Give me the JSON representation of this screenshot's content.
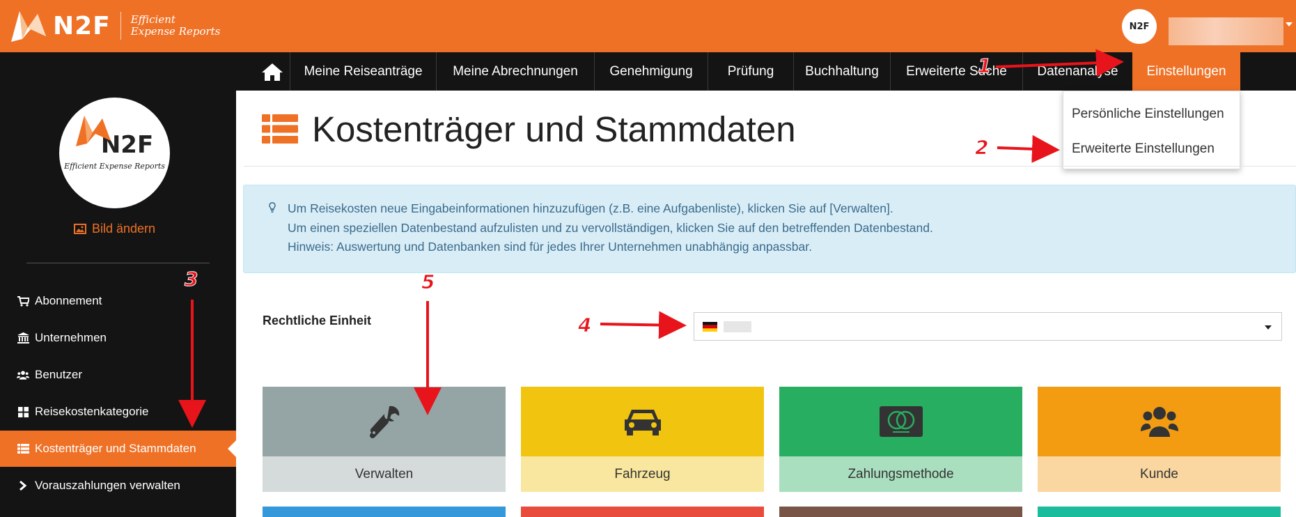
{
  "brand": {
    "logo_text": "N2F",
    "tagline_line1": "Efficient",
    "tagline_line2": "Expense Reports",
    "orange": "#ef7126",
    "dark": "#141414"
  },
  "header": {
    "avatar_text": "N2F"
  },
  "nav": {
    "home_icon": "home-icon",
    "items": [
      {
        "label": "Meine Reiseanträge"
      },
      {
        "label": "Meine Abrechnungen"
      },
      {
        "label": "Genehmigung"
      },
      {
        "label": "Prüfung"
      },
      {
        "label": "Buchhaltung"
      },
      {
        "label": "Erweiterte Suche"
      },
      {
        "label": "Datenanalyse"
      },
      {
        "label": "Einstellungen"
      }
    ]
  },
  "dropdown": {
    "items": [
      {
        "label": "Persönliche Einstellungen"
      },
      {
        "label": "Erweiterte Einstellungen"
      }
    ]
  },
  "sidebar": {
    "change_image": "Bild ändern",
    "logo_text": "N2F",
    "logo_tagline": "Efficient Expense Reports",
    "items": [
      {
        "label": "Abonnement",
        "icon": "cart-icon"
      },
      {
        "label": "Unternehmen",
        "icon": "bank-icon"
      },
      {
        "label": "Benutzer",
        "icon": "users-icon"
      },
      {
        "label": "Reisekostenkategorie",
        "icon": "grid-icon"
      },
      {
        "label": "Kostenträger und Stammdaten",
        "icon": "list-icon",
        "active": true
      },
      {
        "label": "Vorauszahlungen verwalten",
        "icon": "chevron-right-icon"
      }
    ]
  },
  "main": {
    "title": "Kostenträger und Stammdaten",
    "info": {
      "line1": "Um Reisekosten neue Eingabeinformationen hinzuzufügen (z.B. eine Aufgabenliste), klicken Sie auf [Verwalten].",
      "line2": "Um einen speziellen Datenbestand aufzulisten und zu vervollständigen, klicken Sie auf den betreffenden Datenbestand.",
      "line3": "Hinweis: Auswertung und Datenbanken sind für jedes Ihrer Unternehmen unabhängig anpassbar."
    },
    "legal_entity_label": "Rechtliche Einheit",
    "tiles": [
      {
        "label": "Verwalten",
        "icon": "wrench-icon",
        "top_color": "#95a5a6",
        "bottom_color": "#d5dbdb"
      },
      {
        "label": "Fahrzeug",
        "icon": "car-icon",
        "top_color": "#f1c40f",
        "bottom_color": "#f9e79f"
      },
      {
        "label": "Zahlungsmethode",
        "icon": "credit-card-icon",
        "top_color": "#27ae60",
        "bottom_color": "#a9dfbf"
      },
      {
        "label": "Kunde",
        "icon": "users-icon",
        "top_color": "#f39c12",
        "bottom_color": "#fad7a0"
      }
    ],
    "strip_colors": [
      "#3498db",
      "#e74c3c",
      "#795548",
      "#1abc9c"
    ]
  },
  "annotations": {
    "labels": [
      "1",
      "2",
      "3",
      "4",
      "5"
    ],
    "color": "#e8141b"
  }
}
